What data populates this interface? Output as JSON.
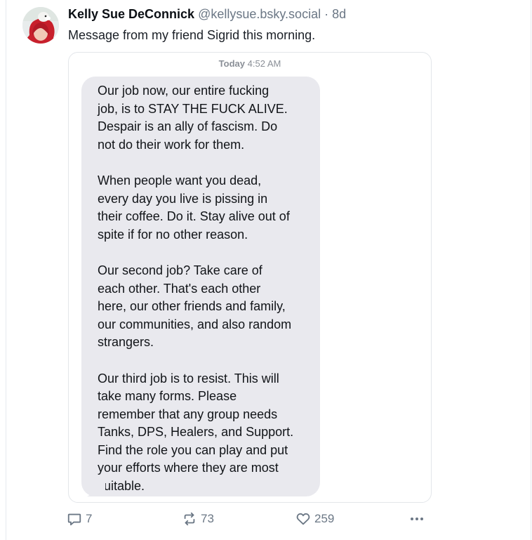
{
  "post": {
    "author_name": "Kelly Sue DeConnick",
    "author_handle": "@kellysue.bsky.social",
    "separator": "·",
    "time_ago": "8d",
    "text": "Message from my friend Sigrid this morning."
  },
  "screenshot": {
    "timestamp_day": "Today",
    "timestamp_time": "4:52 AM",
    "bubble_color": "#e9e9ee",
    "message_lines": [
      "Our job now, our entire fucking",
      "job, is to STAY THE FUCK ALIVE.",
      "Despair is an ally of fascism. Do",
      "not do their work for them.",
      "",
      "When people want you dead,",
      "every day you live is pissing in",
      "their coffee. Do it. Stay alive out of",
      "spite if for no other reason.",
      "",
      "Our second job? Take care of",
      "each other. That's each other",
      "here, our other friends and family,",
      "our communities, and also random",
      "strangers.",
      "",
      "Our third job is to resist. This will",
      "take many forms. Please",
      "remember that any group needs",
      "Tanks, DPS, Healers, and Support.",
      "Find the role you can play and put",
      "your efforts where they are most",
      "suitable."
    ]
  },
  "actions": {
    "reply_icon": "reply-icon",
    "reply_count": "7",
    "repost_icon": "repost-icon",
    "repost_count": "73",
    "like_icon": "heart-icon",
    "like_count": "259",
    "more_icon": "more-icon"
  }
}
